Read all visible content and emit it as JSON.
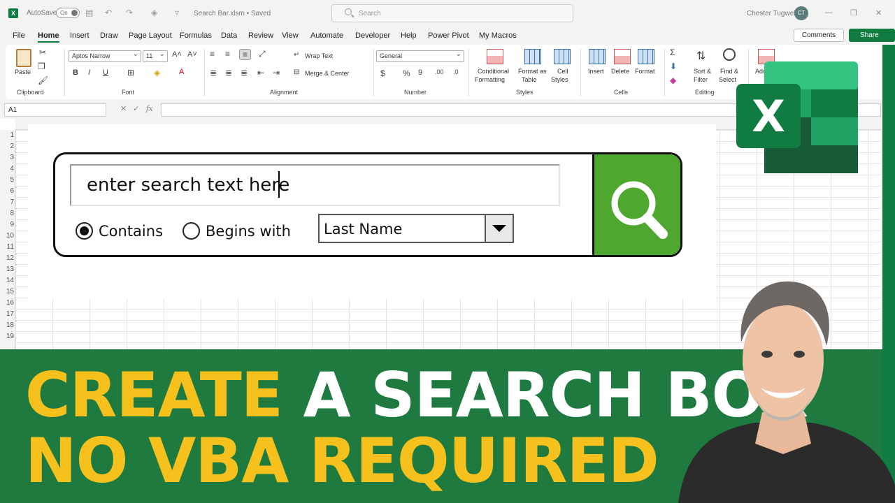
{
  "titlebar": {
    "autosave_label": "AutoSave",
    "autosave_state": "On",
    "filename": "Search Bar.xlsm • Saved",
    "search_placeholder": "Search",
    "user_name": "Chester Tugwell",
    "user_initials": "CT"
  },
  "menu": {
    "tabs": [
      "File",
      "Home",
      "Insert",
      "Draw",
      "Page Layout",
      "Formulas",
      "Data",
      "Review",
      "View",
      "Automate",
      "Developer",
      "Help",
      "Power Pivot",
      "My Macros"
    ],
    "active": "Home",
    "comments": "Comments",
    "share": "Share"
  },
  "ribbon": {
    "clipboard": {
      "paste": "Paste",
      "label": "Clipboard"
    },
    "font": {
      "name": "Aptos Narrow",
      "size": "11",
      "label": "Font"
    },
    "alignment": {
      "wrap": "Wrap Text",
      "merge": "Merge & Center",
      "label": "Alignment"
    },
    "number": {
      "format": "General",
      "label": "Number"
    },
    "styles": {
      "conditional_1": "Conditional",
      "conditional_2": "Formatting",
      "format_table_1": "Format as",
      "format_table_2": "Table",
      "cell_styles_1": "Cell",
      "cell_styles_2": "Styles",
      "label": "Styles"
    },
    "cells": {
      "insert": "Insert",
      "delete": "Delete",
      "format": "Format",
      "label": "Cells"
    },
    "editing": {
      "sort_1": "Sort &",
      "sort_2": "Filter",
      "find_1": "Find &",
      "find_2": "Select",
      "label": "Editing"
    },
    "add": "Add"
  },
  "formula_bar": {
    "name_box": "A1",
    "fx": "fx"
  },
  "rows": [
    "1",
    "2",
    "3",
    "4",
    "5",
    "6",
    "7",
    "8",
    "9",
    "10",
    "11",
    "12",
    "13",
    "14",
    "15",
    "16",
    "17",
    "18",
    "19"
  ],
  "widget": {
    "search_text": "enter search text here",
    "option_contains": "Contains",
    "option_begins": "Begins with",
    "selected_option": "Contains",
    "dropdown_value": "Last Name"
  },
  "banner": {
    "line1_highlight": "CREATE",
    "line1_rest": " A SEARCH BOX",
    "line2": "NO VBA REQUIRED"
  },
  "colors": {
    "excel_green": "#107c41",
    "banner_green": "#1e7a3f",
    "search_button_green": "#4ea72e",
    "banner_yellow": "#f6c11c"
  }
}
